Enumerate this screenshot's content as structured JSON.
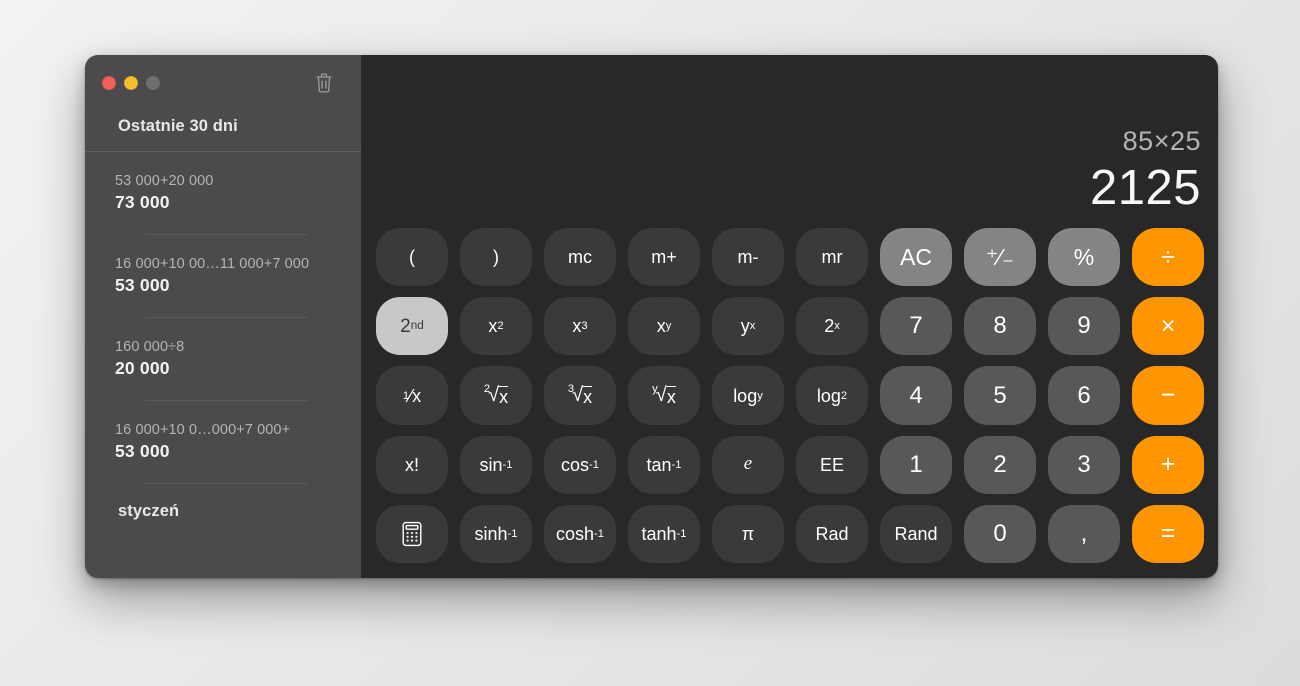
{
  "window": {
    "traffic_lights": [
      {
        "name": "close",
        "color": "#f2605a"
      },
      {
        "name": "minimize",
        "color": "#f5bd2e"
      },
      {
        "name": "zoom",
        "color": "#6e6e6e"
      }
    ],
    "trash_icon": "trash-icon"
  },
  "sidebar": {
    "header": "Ostatnie 30 dni",
    "month_label": "styczeń",
    "history": [
      {
        "expression": "53 000+20 000",
        "result": "73 000"
      },
      {
        "expression": "16 000+10 00…11 000+7 000",
        "result": "53 000"
      },
      {
        "expression": "160 000÷8",
        "result": "20 000"
      },
      {
        "expression": "16 000+10 0…000+7 000+",
        "result": "53 000"
      }
    ]
  },
  "display": {
    "expression": "85×25",
    "result": "2125"
  },
  "colors": {
    "accent_orange": "#ff9500",
    "key_function": "#3a3a3a",
    "key_digit": "#585858",
    "key_utility": "#848484",
    "key_active": "#c8c8c8",
    "keypad_bg": "#282828",
    "sidebar_bg": "#4b4b4b"
  },
  "keypad": {
    "rows": [
      [
        {
          "name": "paren-open",
          "label": "(",
          "type": "func"
        },
        {
          "name": "paren-close",
          "label": ")",
          "type": "func"
        },
        {
          "name": "memory-clear",
          "label": "mc",
          "type": "func"
        },
        {
          "name": "memory-add",
          "label": "m+",
          "type": "func"
        },
        {
          "name": "memory-sub",
          "label": "m-",
          "type": "func"
        },
        {
          "name": "memory-recall",
          "label": "mr",
          "type": "func"
        },
        {
          "name": "all-clear",
          "label": "AC",
          "type": "util"
        },
        {
          "name": "sign-toggle",
          "label": "⁺∕₋",
          "type": "util"
        },
        {
          "name": "percent",
          "label": "%",
          "type": "util"
        },
        {
          "name": "divide",
          "label": "÷",
          "type": "op"
        }
      ],
      [
        {
          "name": "second-function",
          "label": "2nd",
          "type": "active",
          "html": "2<sup>nd</sup>"
        },
        {
          "name": "x-squared",
          "label": "x²",
          "type": "func",
          "html": "x<sup>2</sup>"
        },
        {
          "name": "x-cubed",
          "label": "x³",
          "type": "func",
          "html": "x<sup>3</sup>"
        },
        {
          "name": "x-power-y",
          "label": "xʸ",
          "type": "func",
          "html": "x<sup>y</sup>"
        },
        {
          "name": "y-power-x",
          "label": "yˣ",
          "type": "func",
          "html": "y<sup>x</sup>"
        },
        {
          "name": "two-power-x",
          "label": "2ˣ",
          "type": "func",
          "html": "2<sup>x</sup>"
        },
        {
          "name": "digit-7",
          "label": "7",
          "type": "digit"
        },
        {
          "name": "digit-8",
          "label": "8",
          "type": "digit"
        },
        {
          "name": "digit-9",
          "label": "9",
          "type": "digit"
        },
        {
          "name": "multiply",
          "label": "×",
          "type": "op"
        }
      ],
      [
        {
          "name": "reciprocal",
          "label": "¹⁄x",
          "type": "func",
          "html": "<sup>1</sup>⁄x"
        },
        {
          "name": "square-root",
          "label": "²√x",
          "type": "func",
          "html": "<span class=\"radical\"><span class=\"idx\">2</span><span class=\"rad\">√</span></span><span style=\"border-top:1px solid #fff;padding-top:1px;\">x</span>"
        },
        {
          "name": "cube-root",
          "label": "³√x",
          "type": "func",
          "html": "<span class=\"radical\"><span class=\"idx\">3</span><span class=\"rad\">√</span></span><span style=\"border-top:1px solid #fff;padding-top:1px;\">x</span>"
        },
        {
          "name": "nth-root",
          "label": "ʸ√x",
          "type": "func",
          "html": "<span class=\"radical\"><span class=\"idx\">y</span><span class=\"rad\">√</span></span><span style=\"border-top:1px solid #fff;padding-top:1px;\">x</span>"
        },
        {
          "name": "log-base-y",
          "label": "logy",
          "type": "func",
          "html": "log<sub>y</sub>"
        },
        {
          "name": "log-base-2",
          "label": "log₂",
          "type": "func",
          "html": "log<sub>2</sub>"
        },
        {
          "name": "digit-4",
          "label": "4",
          "type": "digit"
        },
        {
          "name": "digit-5",
          "label": "5",
          "type": "digit"
        },
        {
          "name": "digit-6",
          "label": "6",
          "type": "digit"
        },
        {
          "name": "subtract",
          "label": "−",
          "type": "op"
        }
      ],
      [
        {
          "name": "factorial",
          "label": "x!",
          "type": "func"
        },
        {
          "name": "arcsine",
          "label": "sin⁻¹",
          "type": "func",
          "html": "sin<sup>-1</sup>"
        },
        {
          "name": "arccosine",
          "label": "cos⁻¹",
          "type": "func",
          "html": "cos<sup>-1</sup>"
        },
        {
          "name": "arctangent",
          "label": "tan⁻¹",
          "type": "func",
          "html": "tan<sup>-1</sup>"
        },
        {
          "name": "euler-number",
          "label": "e",
          "type": "func",
          "html": "<span class=\"ital\">e</span>"
        },
        {
          "name": "exponent-ee",
          "label": "EE",
          "type": "func"
        },
        {
          "name": "digit-1",
          "label": "1",
          "type": "digit"
        },
        {
          "name": "digit-2",
          "label": "2",
          "type": "digit"
        },
        {
          "name": "digit-3",
          "label": "3",
          "type": "digit"
        },
        {
          "name": "add",
          "label": "+",
          "type": "op"
        }
      ],
      [
        {
          "name": "calculator-mode",
          "label": "",
          "type": "func",
          "icon": "calculator-icon"
        },
        {
          "name": "arc-sinh",
          "label": "sinh⁻¹",
          "type": "func",
          "html": "sinh<sup>-1</sup>"
        },
        {
          "name": "arc-cosh",
          "label": "cosh⁻¹",
          "type": "func",
          "html": "cosh<sup>-1</sup>"
        },
        {
          "name": "arc-tanh",
          "label": "tanh⁻¹",
          "type": "func",
          "html": "tanh<sup>-1</sup>"
        },
        {
          "name": "pi",
          "label": "π",
          "type": "func"
        },
        {
          "name": "radians-toggle",
          "label": "Rad",
          "type": "func"
        },
        {
          "name": "random",
          "label": "Rand",
          "type": "func"
        },
        {
          "name": "digit-0",
          "label": "0",
          "type": "digit"
        },
        {
          "name": "decimal-comma",
          "label": ",",
          "type": "digit"
        },
        {
          "name": "equals",
          "label": "=",
          "type": "op"
        }
      ]
    ]
  }
}
